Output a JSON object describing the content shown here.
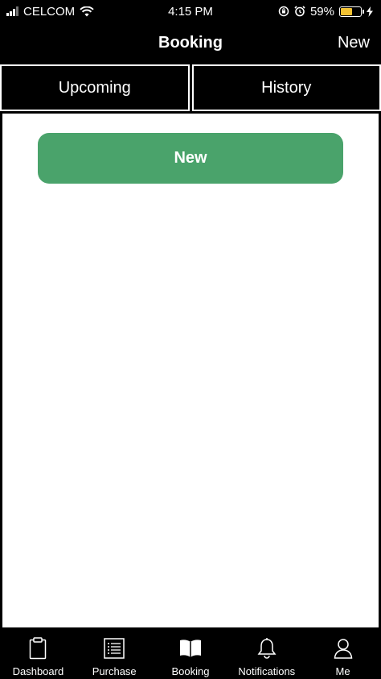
{
  "status_bar": {
    "carrier": "CELCOM",
    "time": "4:15 PM",
    "battery_percent": "59%",
    "battery_level": 0.59,
    "battery_color": "#f3c233"
  },
  "nav": {
    "title": "Booking",
    "right_action": "New"
  },
  "tabs": [
    {
      "label": "Upcoming"
    },
    {
      "label": "History"
    }
  ],
  "content": {
    "new_button_label": "New",
    "button_color": "#4aa36b"
  },
  "tab_bar": {
    "items": [
      {
        "label": "Dashboard",
        "icon": "clipboard-icon"
      },
      {
        "label": "Purchase",
        "icon": "list-icon"
      },
      {
        "label": "Booking",
        "icon": "book-icon",
        "selected": true
      },
      {
        "label": "Notifications",
        "icon": "bell-icon"
      },
      {
        "label": "Me",
        "icon": "person-icon"
      }
    ]
  }
}
